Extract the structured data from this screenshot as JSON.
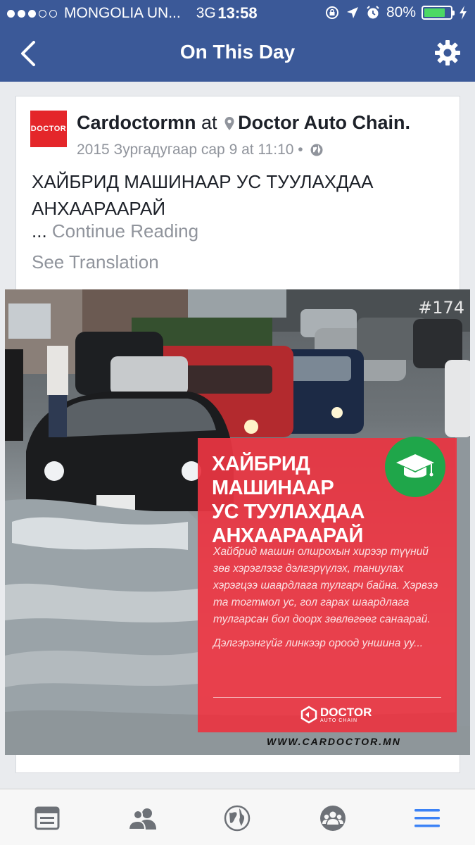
{
  "status_bar": {
    "carrier": "MONGOLIA UN...",
    "network": "3G",
    "time": "13:58",
    "battery": "80%",
    "battery_level": 0.8
  },
  "nav": {
    "title": "On This Day",
    "back_icon": "chevron-left-icon",
    "settings_icon": "gear-icon"
  },
  "post": {
    "author": "Cardoctormn",
    "at_text": "at",
    "place": "Doctor Auto Chain.",
    "timestamp": "2015 Зургадугаар сар 9 at 11:10",
    "separator": "•",
    "text_line1": "ХАЙБРИД МАШИНААР УС ТУУЛАХДАА",
    "text_line2": "АНХААРААРАЙ",
    "ellipsis": "...",
    "continue_reading": "Continue Reading",
    "see_translation": "See Translation",
    "avatar_text": "DOCTOR"
  },
  "image": {
    "corner_number": "#174",
    "title_line1": "ХАЙБРИД МАШИНААР",
    "title_line2": "УС ТУУЛАХДАА",
    "title_line3": "АНХААРААРАЙ",
    "body": "Хайбрид машин олшрохын хирээр түүний зөв хэрэглээг дэлгэрүүлэх, таниулах хэрэгцээ шаардлага тулгарч байна. Хэрвээ та тогтмол ус, гол гарах шаардлага тулгарсан бол доорх зөвлөгөөг санаарай.",
    "link_text": "Дэлгэрэнгүйг линкээр ороод уншина уу...",
    "logo_text": "DOCTOR",
    "logo_sub": "AUTO CHAIN",
    "website": "WWW.CARDOCTOR.MN",
    "panel_color": "#e93542",
    "badge_color": "#1fa64a"
  },
  "tabbar": {
    "items": [
      "news-feed-icon",
      "friends-icon",
      "globe-icon",
      "groups-icon",
      "menu-icon"
    ],
    "active_color": "#3b82f6"
  },
  "colors": {
    "header": "#3b5998",
    "muted_text": "#90949c"
  }
}
